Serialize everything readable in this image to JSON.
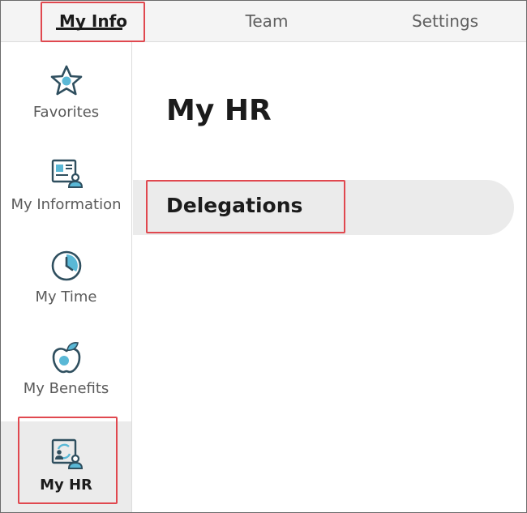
{
  "tabs": [
    {
      "label": "My Info"
    },
    {
      "label": "Team"
    },
    {
      "label": "Settings"
    }
  ],
  "sidebar": {
    "items": [
      {
        "label": "Favorites",
        "icon": "star-icon"
      },
      {
        "label": "My Information",
        "icon": "id-card-icon"
      },
      {
        "label": "My Time",
        "icon": "clock-icon"
      },
      {
        "label": "My Benefits",
        "icon": "apple-icon"
      },
      {
        "label": "My HR",
        "icon": "hr-profile-icon"
      }
    ]
  },
  "main": {
    "title": "My HR",
    "rows": [
      {
        "label": "Delegations"
      }
    ]
  },
  "colors": {
    "accent": "#5ab8d6",
    "icon_stroke": "#2f4f5f",
    "highlight": "#e0484f",
    "active_bg": "#ebebeb"
  }
}
